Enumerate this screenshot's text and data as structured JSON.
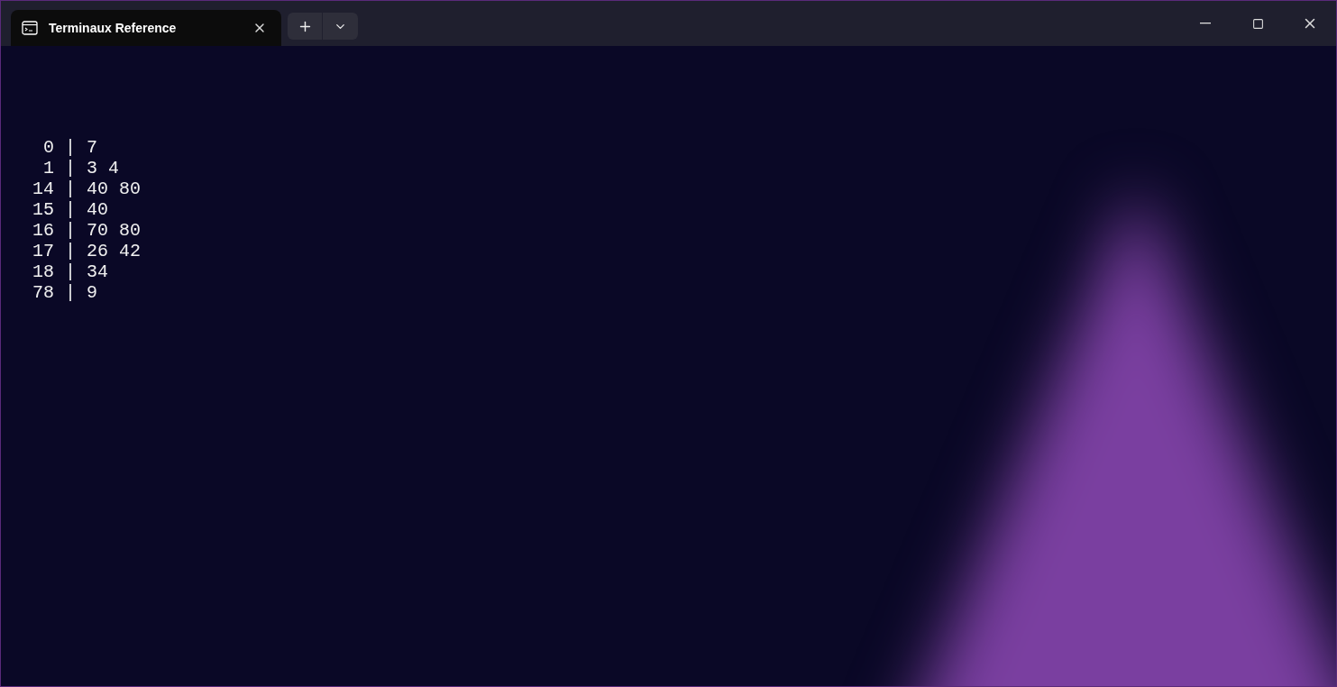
{
  "tabs": [
    {
      "title": "Terminaux Reference",
      "selected": true
    }
  ],
  "terminal": {
    "lines": [
      "  0 | 7",
      "  1 | 3 4",
      " 14 | 40 80",
      " 15 | 40",
      " 16 | 70 80",
      " 17 | 26 42",
      " 18 | 34",
      " 78 | 9"
    ]
  }
}
